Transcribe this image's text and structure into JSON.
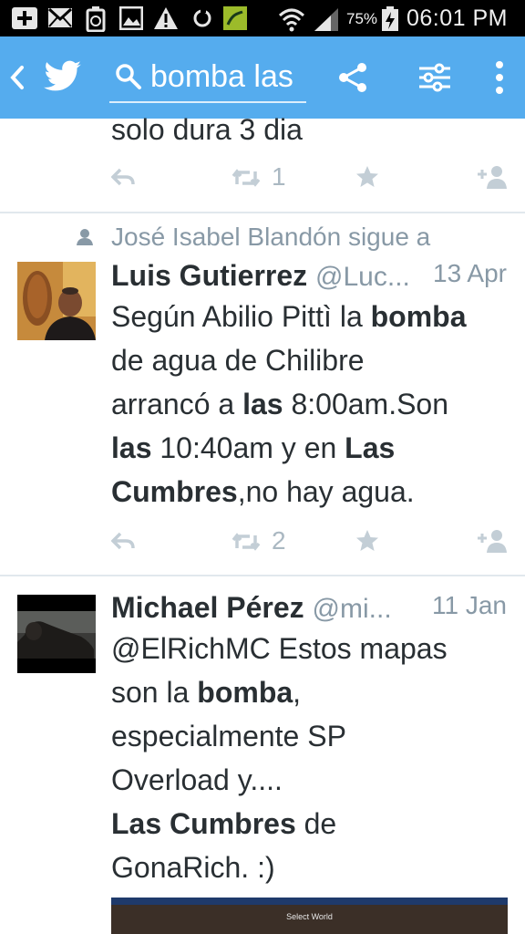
{
  "status_bar": {
    "battery_percent": "75%",
    "time": "06:01 PM"
  },
  "toolbar": {
    "search_value": "bomba las",
    "colors": {
      "bar": "#55acee",
      "text": "#ffffff"
    }
  },
  "tweets": [
    {
      "partial_text": "solo dura 3 dia",
      "retweets": "1"
    },
    {
      "context": "José Isabel Blandón  sigue a",
      "name": "Luis Gutierrez",
      "handle": "@Luc...",
      "date": "13 Apr",
      "text": [
        [
          "Según Abilio Pittì la ",
          "bomba"
        ],
        [
          "de agua de Chilibre"
        ],
        [
          "arrancó a ",
          "las",
          " 8:00am.Son"
        ],
        [
          "las",
          " 10:40am y en ",
          "Las"
        ],
        [
          "Cumbres",
          ",no hay agua."
        ]
      ],
      "retweets": "2"
    },
    {
      "name": "Michael Pérez",
      "handle": "@mi...",
      "date": "11 Jan",
      "text": [
        [
          "@ElRichMC Estos mapas"
        ],
        [
          "son la ",
          "bomba",
          ","
        ],
        [
          "especialmente SP"
        ],
        [
          "Overload y...."
        ],
        [
          "Las Cumbres",
          " de"
        ],
        [
          "GonaRich. :)"
        ]
      ],
      "media_caption": "Select World"
    }
  ]
}
